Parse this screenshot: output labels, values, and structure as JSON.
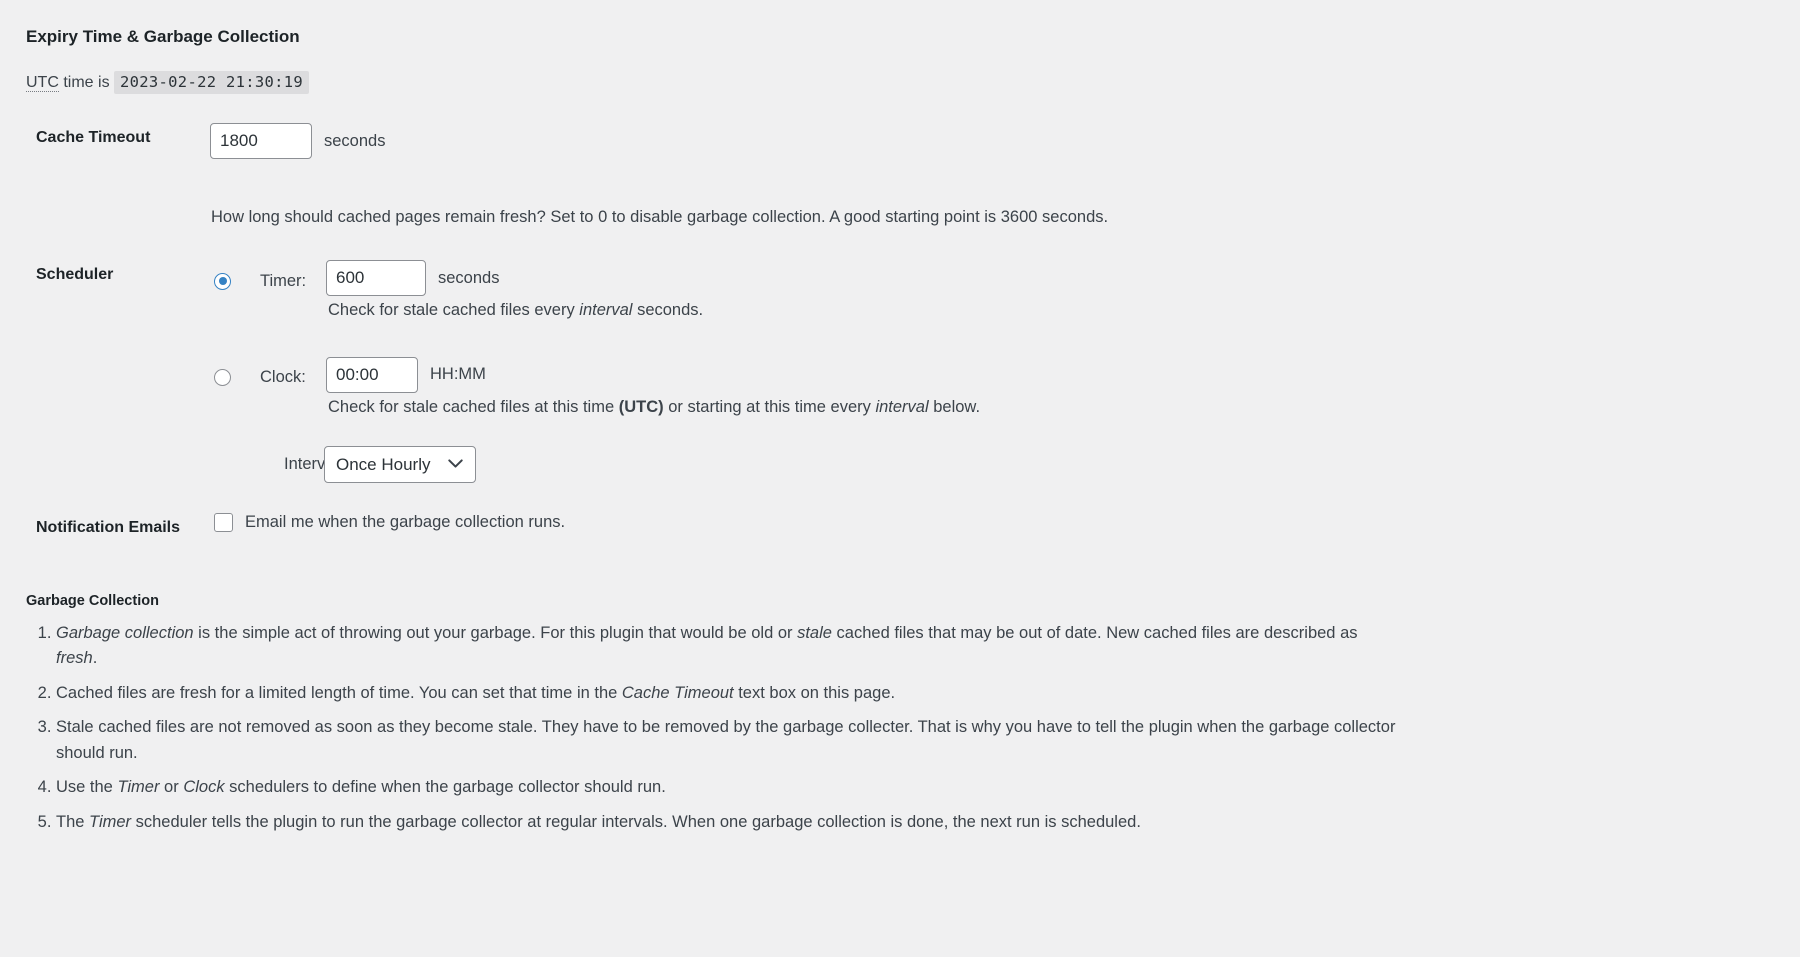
{
  "section": {
    "title": "Expiry Time & Garbage Collection",
    "utc_prefix": "UTC",
    "utc_middle": " time is ",
    "utc_value": "2023-02-22 21:30:19"
  },
  "cache_timeout": {
    "label": "Cache Timeout",
    "value": "1800",
    "unit": "seconds",
    "description": "How long should cached pages remain fresh? Set to 0 to disable garbage collection. A good starting point is 3600 seconds."
  },
  "scheduler": {
    "label": "Scheduler",
    "timer": {
      "label": "Timer:",
      "value": "600",
      "unit": "seconds",
      "selected": true,
      "desc_before": "Check for stale cached files every ",
      "desc_em": "interval",
      "desc_after": " seconds."
    },
    "clock": {
      "label": "Clock:",
      "value": "00:00",
      "unit": "HH:MM",
      "selected": false,
      "desc_before": "Check for stale cached files at this time ",
      "desc_strong": "(UTC)",
      "desc_middle": " or starting at this time every ",
      "desc_em": "interval",
      "desc_after": " below."
    },
    "interval": {
      "label": "Interval:",
      "selected": "Once Hourly",
      "options": [
        "Once Hourly"
      ]
    }
  },
  "notification": {
    "label": "Notification Emails",
    "checkbox_label": "Email me when the garbage collection runs.",
    "checked": false
  },
  "garbage_collection": {
    "title": "Garbage Collection",
    "items": [
      {
        "parts": [
          {
            "t": "em",
            "v": "Garbage collection"
          },
          {
            "t": "text",
            "v": " is the simple act of throwing out your garbage. For this plugin that would be old or "
          },
          {
            "t": "em",
            "v": "stale"
          },
          {
            "t": "text",
            "v": " cached files that may be out of date. New cached files are described as "
          },
          {
            "t": "em",
            "v": "fresh"
          },
          {
            "t": "text",
            "v": "."
          }
        ]
      },
      {
        "parts": [
          {
            "t": "text",
            "v": "Cached files are fresh for a limited length of time. You can set that time in the "
          },
          {
            "t": "em",
            "v": "Cache Timeout"
          },
          {
            "t": "text",
            "v": " text box on this page."
          }
        ]
      },
      {
        "parts": [
          {
            "t": "text",
            "v": "Stale cached files are not removed as soon as they become stale. They have to be removed by the garbage collecter. That is why you have to tell the plugin when the garbage collector should run."
          }
        ]
      },
      {
        "parts": [
          {
            "t": "text",
            "v": "Use the "
          },
          {
            "t": "em",
            "v": "Timer"
          },
          {
            "t": "text",
            "v": " or "
          },
          {
            "t": "em",
            "v": "Clock"
          },
          {
            "t": "text",
            "v": " schedulers to define when the garbage collector should run."
          }
        ]
      },
      {
        "parts": [
          {
            "t": "text",
            "v": "The "
          },
          {
            "t": "em",
            "v": "Timer"
          },
          {
            "t": "text",
            "v": " scheduler tells the plugin to run the garbage collector at regular intervals. When one garbage collection is done, the next run is scheduled."
          }
        ]
      }
    ]
  },
  "colors": {
    "accent": "#3582c4",
    "background": "#f0f0f1",
    "text": "#3c434a",
    "heading": "#1d2327",
    "border": "#8c8f94",
    "code_bg": "#dcdcde"
  }
}
